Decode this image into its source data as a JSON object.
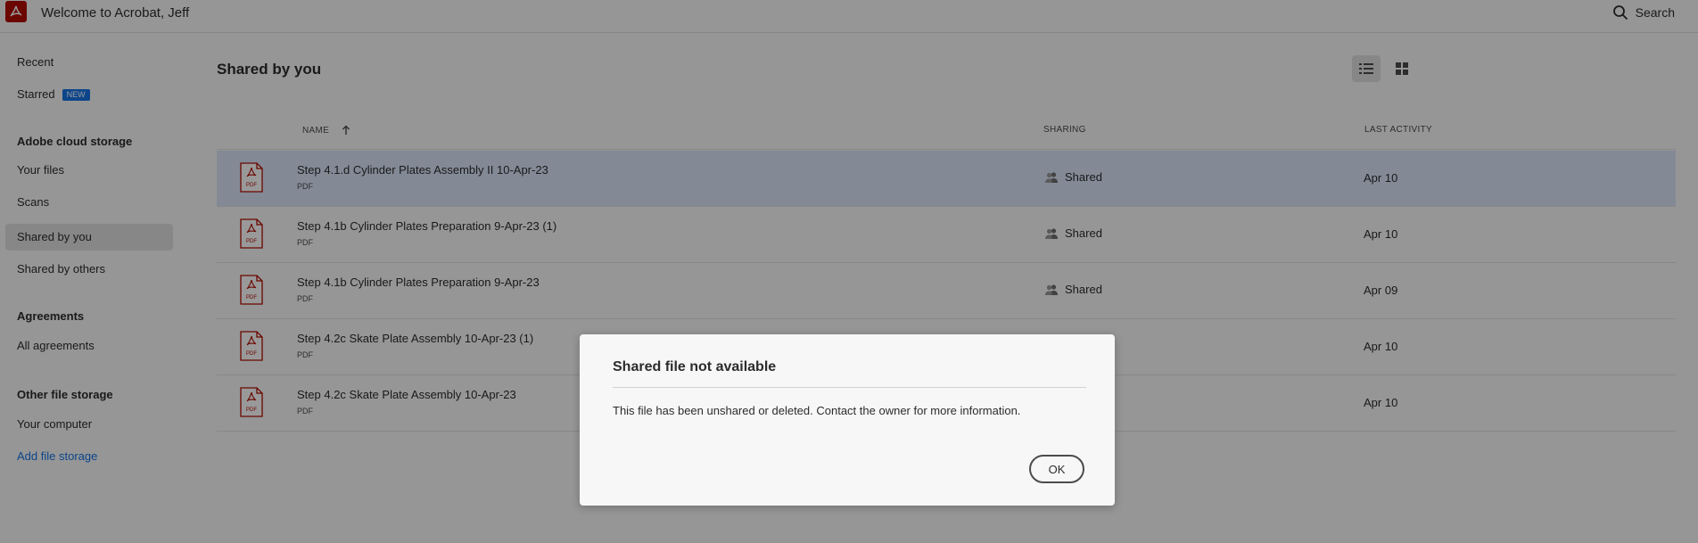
{
  "header": {
    "app_title": "Welcome to Acrobat, Jeff",
    "search_label": "Search"
  },
  "sidebar": {
    "recent": "Recent",
    "starred": "Starred",
    "new_badge": "NEW",
    "cloud_heading": "Adobe cloud storage",
    "your_files": "Your files",
    "scans": "Scans",
    "shared_by_you": "Shared by you",
    "shared_by_others": "Shared by others",
    "agreements_heading": "Agreements",
    "all_agreements": "All agreements",
    "other_heading": "Other file storage",
    "your_computer": "Your computer",
    "add_file_storage": "Add file storage"
  },
  "main": {
    "title": "Shared by you",
    "columns": {
      "name": "NAME",
      "sharing": "SHARING",
      "last_activity": "LAST ACTIVITY"
    },
    "files": [
      {
        "name": "Step 4.1.d Cylinder Plates Assembly II 10-Apr-23",
        "type": "PDF",
        "sharing": "Shared",
        "last_activity": "Apr 10",
        "selected": true
      },
      {
        "name": "Step 4.1b Cylinder Plates Preparation 9-Apr-23 (1)",
        "type": "PDF",
        "sharing": "Shared",
        "last_activity": "Apr 10"
      },
      {
        "name": "Step 4.1b Cylinder Plates Preparation 9-Apr-23",
        "type": "PDF",
        "sharing": "Shared",
        "last_activity": "Apr 09"
      },
      {
        "name": "Step 4.2c Skate Plate Assembly 10-Apr-23 (1)",
        "type": "PDF",
        "sharing": "",
        "last_activity": "Apr 10"
      },
      {
        "name": "Step 4.2c Skate Plate Assembly 10-Apr-23",
        "type": "PDF",
        "sharing": "",
        "last_activity": "Apr 10"
      }
    ],
    "pdf_icon_label": "PDF"
  },
  "dialog": {
    "title": "Shared file not available",
    "message": "This file has been unshared or deleted. Contact the owner for more information.",
    "ok_label": "OK"
  },
  "colors": {
    "brand_red": "#b30b00",
    "link_blue": "#1473e6",
    "selected_row": "#dae7fb"
  }
}
